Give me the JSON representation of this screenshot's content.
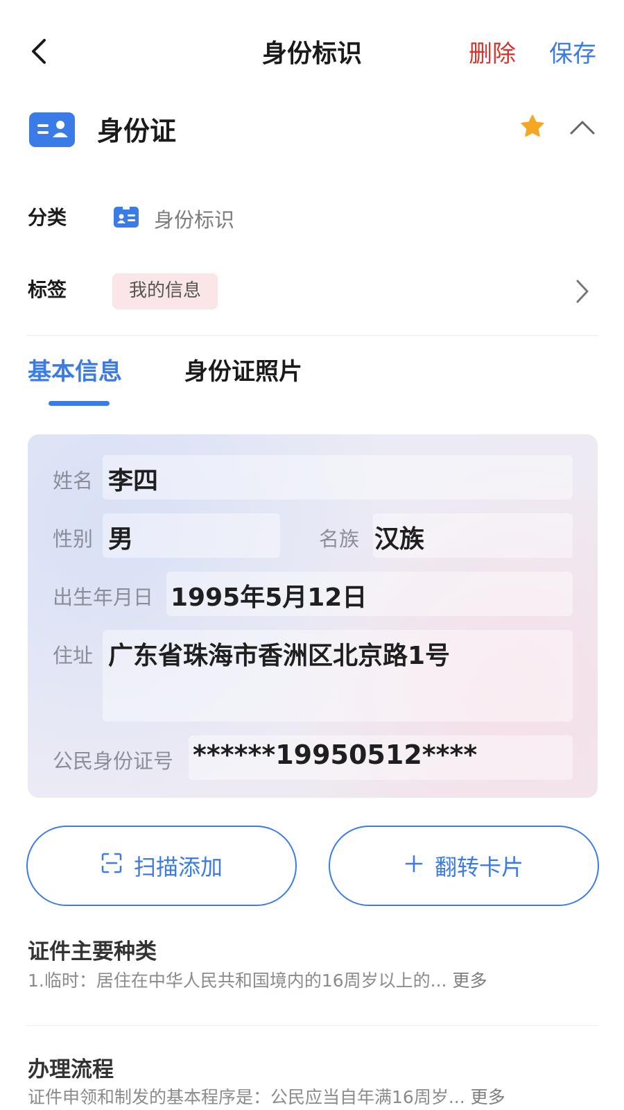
{
  "header": {
    "title": "身份标识",
    "delete_label": "删除",
    "save_label": "保存"
  },
  "document": {
    "title": "身份证",
    "favorite": true
  },
  "category": {
    "label": "分类",
    "value": "身份标识"
  },
  "tags": {
    "label": "标签",
    "items": [
      "我的信息"
    ]
  },
  "tabs": [
    {
      "label": "基本信息",
      "active": true
    },
    {
      "label": "身份证照片",
      "active": false
    }
  ],
  "id_card": {
    "name_label": "姓名",
    "name_value": "李四",
    "gender_label": "性别",
    "gender_value": "男",
    "ethnicity_label": "名族",
    "ethnicity_value": "汉族",
    "birth_label": "出生年月日",
    "birth_value": "1995年5月12日",
    "address_label": "住址",
    "address_value": "广东省珠海市香洲区北京路1号",
    "id_label": "公民身份证号",
    "id_value": "******19950512****"
  },
  "actions": {
    "scan_label": "扫描添加",
    "flip_label": "翻转卡片"
  },
  "sections": [
    {
      "title": "证件主要种类",
      "text": "1.临时：居住在中华人民共和国境内的16周岁以上的...",
      "more": "更多"
    },
    {
      "title": "办理流程",
      "text": "证件申领和制发的基本程序是：公民应当自年满16周岁...",
      "more": "更多"
    }
  ],
  "colors": {
    "accent": "#3b7be8",
    "danger": "#d9342b",
    "star": "#f5a623",
    "tag_bg": "#fbe6e7"
  }
}
